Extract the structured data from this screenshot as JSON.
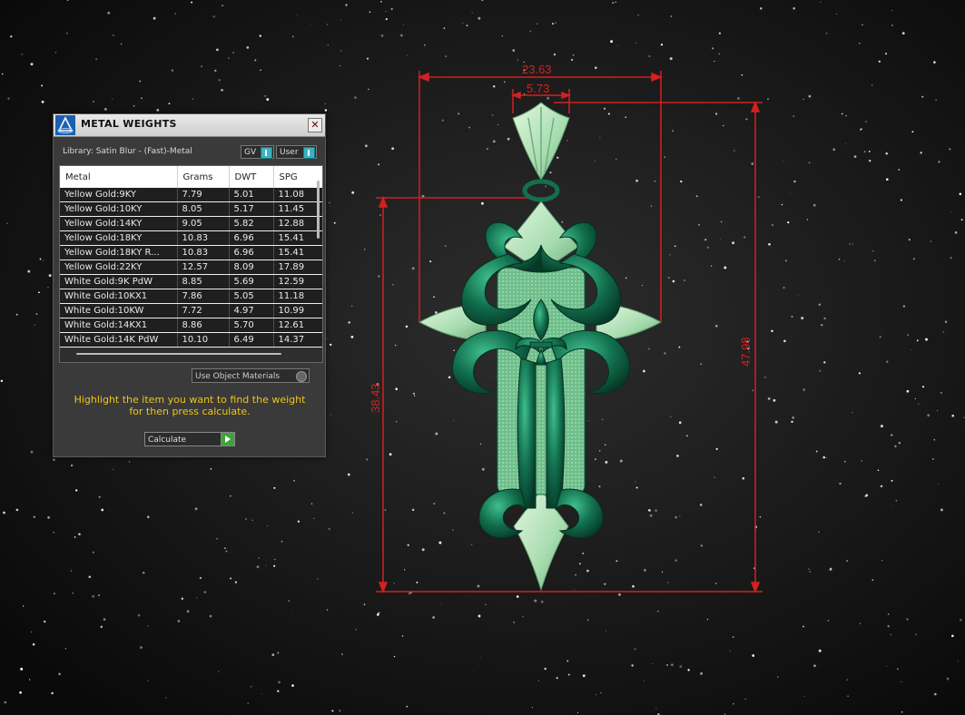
{
  "panel": {
    "title": "METAL WEIGHTS",
    "close_glyph": "✕",
    "library_label": "Library: Satin Blur - (Fast)-Metal",
    "gv_toggle": "GV",
    "user_toggle": "User",
    "columns": [
      "Metal",
      "Grams",
      "DWT",
      "SPG"
    ],
    "rows": [
      {
        "metal": "Yellow Gold:9KY",
        "grams": "7.79",
        "dwt": "5.01",
        "spg": "11.08"
      },
      {
        "metal": "Yellow Gold:10KY",
        "grams": "8.05",
        "dwt": "5.17",
        "spg": "11.45"
      },
      {
        "metal": "Yellow Gold:14KY",
        "grams": "9.05",
        "dwt": "5.82",
        "spg": "12.88"
      },
      {
        "metal": "Yellow Gold:18KY",
        "grams": "10.83",
        "dwt": "6.96",
        "spg": "15.41"
      },
      {
        "metal": "Yellow Gold:18KY R...",
        "grams": "10.83",
        "dwt": "6.96",
        "spg": "15.41"
      },
      {
        "metal": "Yellow Gold:22KY",
        "grams": "12.57",
        "dwt": "8.09",
        "spg": "17.89"
      },
      {
        "metal": "White Gold:9K PdW",
        "grams": "8.85",
        "dwt": "5.69",
        "spg": "12.59"
      },
      {
        "metal": "White Gold:10KX1",
        "grams": "7.86",
        "dwt": "5.05",
        "spg": "11.18"
      },
      {
        "metal": "White Gold:10KW",
        "grams": "7.72",
        "dwt": "4.97",
        "spg": "10.99"
      },
      {
        "metal": "White Gold:14KX1",
        "grams": "8.86",
        "dwt": "5.70",
        "spg": "12.61"
      },
      {
        "metal": "White Gold:14K PdW",
        "grams": "10.10",
        "dwt": "6.49",
        "spg": "14.37"
      }
    ],
    "use_object_materials": "Use Object Materials",
    "hint": "Highlight the item you want to find the weight for then press calculate.",
    "calculate_button": "Calculate"
  },
  "dimensions": {
    "width_overall": "23.63",
    "width_bail": "5.73",
    "height_body": "38.43",
    "height_overall": "47.98"
  },
  "colors": {
    "dimension_line": "#d42020",
    "hint_text": "#f0c419",
    "model_dark_green": "#0f6b4c",
    "model_light_green": "#a8ddb0"
  },
  "icons": {
    "app_logo": "app-logo-icon",
    "close": "close-icon",
    "calculate": "play-icon"
  }
}
